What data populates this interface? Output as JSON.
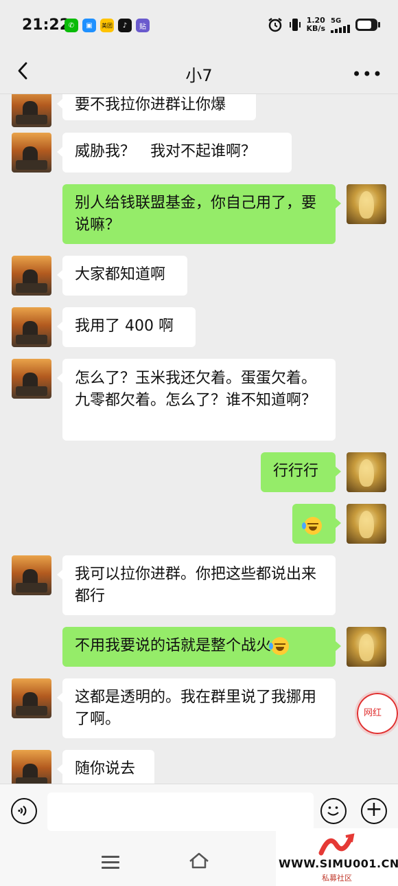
{
  "status_bar": {
    "time": "21:22",
    "app_icons": [
      {
        "name": "wechat-icon",
        "color": "#09bb07",
        "glyph": "✆"
      },
      {
        "name": "app-icon-blue",
        "color": "#1e90ff",
        "glyph": "▣"
      },
      {
        "name": "meituan-icon",
        "color": "#ffc300",
        "glyph": "美团"
      },
      {
        "name": "tiktok-icon",
        "color": "#111111",
        "glyph": "♪"
      },
      {
        "name": "tieba-icon",
        "color": "#6a5acd",
        "glyph": "贴"
      }
    ],
    "net_speed_value": "1.20",
    "net_speed_unit": "KB/s",
    "network": "5G"
  },
  "header": {
    "title": "小7",
    "back_icon": "chevron-left-icon",
    "more_icon": "more-horizontal-icon",
    "more_glyph": "•••"
  },
  "messages": [
    {
      "side": "left",
      "text": "要不我拉你进群让你爆"
    },
    {
      "side": "left",
      "text": "威胁我？　我对不起谁啊？"
    },
    {
      "side": "right",
      "text": "别人给钱联盟基金，你自己用了，要说嘛？"
    },
    {
      "side": "left",
      "text": "大家都知道啊"
    },
    {
      "side": "left",
      "text": "我用了 400 啊"
    },
    {
      "side": "left",
      "text": "怎么了？玉米我还欠着。蛋蛋欠着。九零都欠着。怎么了？谁不知道啊？"
    },
    {
      "side": "right",
      "text": "行行行"
    },
    {
      "side": "right",
      "text": "",
      "emoji": "crying-laughing-emoji"
    },
    {
      "side": "left",
      "text": "我可以拉你进群。你把这些都说出来都行"
    },
    {
      "side": "right",
      "text": "不用我要说的话就是整个战火",
      "emoji": "crying-laughing-emoji"
    },
    {
      "side": "left",
      "text": "这都是透明的。我在群里说了我挪用了啊。"
    },
    {
      "side": "left",
      "text": "随你说去"
    }
  ],
  "floating_badge": {
    "label": "网红"
  },
  "input_bar": {
    "value": "",
    "voice_icon": "voice-icon",
    "emoji_icon": "smiley-icon",
    "plus_icon": "plus-icon",
    "plus_glyph": "+"
  },
  "system_nav": {
    "menu_icon": "menu-icon",
    "home_icon": "home-icon"
  },
  "site_watermark": {
    "url": "WWW.SIMU001.CN",
    "name": "私募社区"
  },
  "colors": {
    "background": "#ededed",
    "bubble_left": "#ffffff",
    "bubble_right": "#95ec69"
  }
}
